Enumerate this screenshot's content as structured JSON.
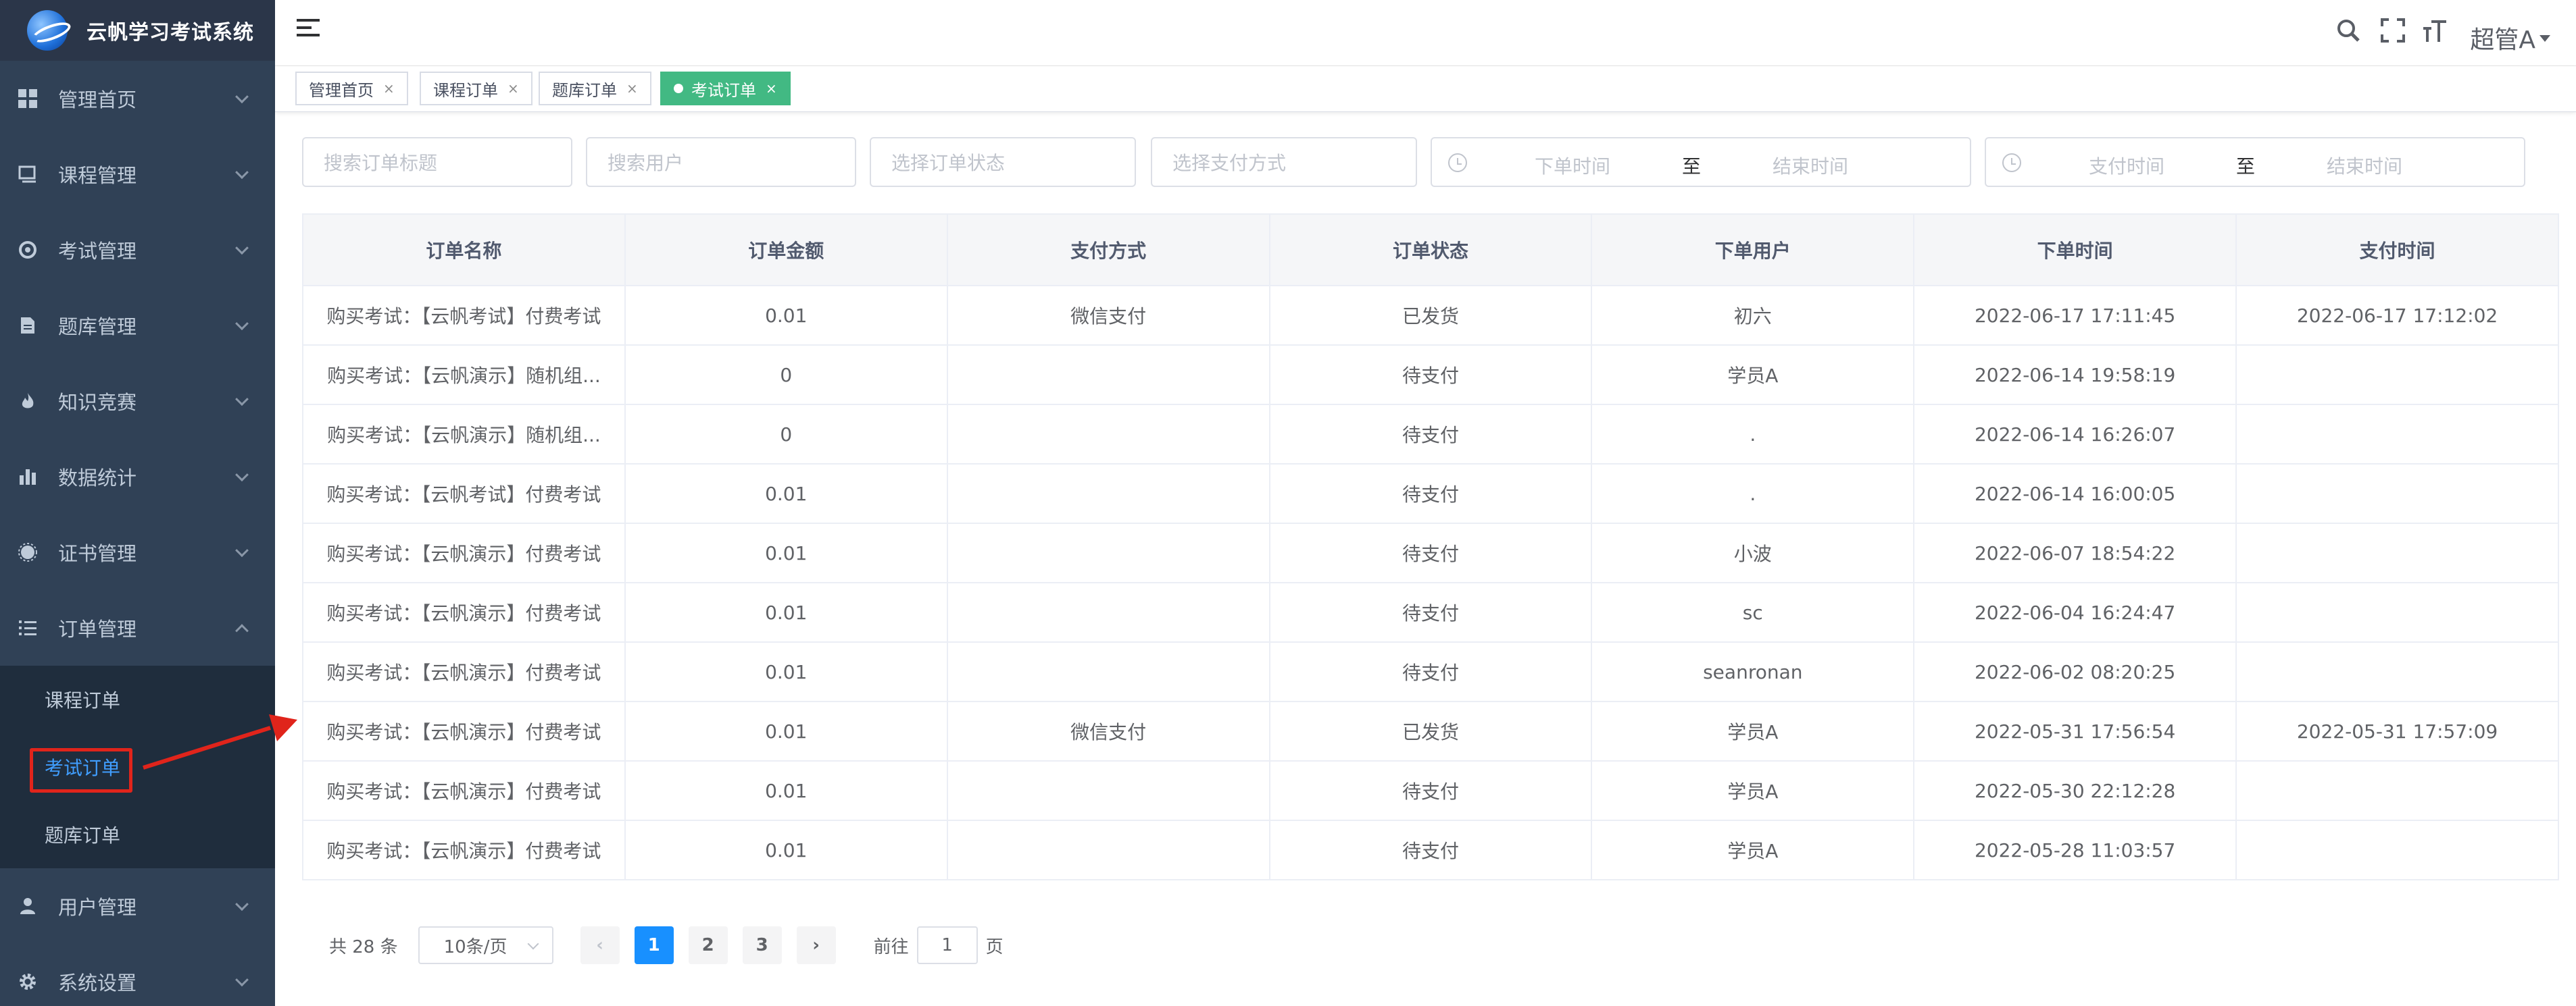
{
  "app": {
    "title": "云帆学习考试系统"
  },
  "colors": {
    "sidebar_bg": "#304156",
    "active_tag": "#42b983",
    "primary": "#1890ff",
    "annotation": "#e0241b"
  },
  "sidebar": {
    "items": [
      {
        "label": "管理首页",
        "icon": "dashboard-icon"
      },
      {
        "label": "课程管理",
        "icon": "book-icon"
      },
      {
        "label": "考试管理",
        "icon": "exam-icon"
      },
      {
        "label": "题库管理",
        "icon": "document-icon"
      },
      {
        "label": "知识竞赛",
        "icon": "fire-icon"
      },
      {
        "label": "数据统计",
        "icon": "bar-chart-icon"
      },
      {
        "label": "证书管理",
        "icon": "certificate-icon"
      },
      {
        "label": "订单管理",
        "icon": "list-icon"
      }
    ],
    "order_sub": [
      {
        "label": "课程订单"
      },
      {
        "label": "考试订单"
      },
      {
        "label": "题库订单"
      }
    ],
    "bottom_items": [
      {
        "label": "用户管理",
        "icon": "user-icon"
      },
      {
        "label": "系统设置",
        "icon": "gear-icon"
      }
    ]
  },
  "header": {
    "user": "超管A"
  },
  "tags": [
    {
      "label": "管理首页"
    },
    {
      "label": "课程订单"
    },
    {
      "label": "题库订单"
    },
    {
      "label": "考试订单"
    }
  ],
  "filters": {
    "title_placeholder": "搜索订单标题",
    "user_placeholder": "搜索用户",
    "state_placeholder": "选择订单状态",
    "pay_placeholder": "选择支付方式",
    "order_time_start": "下单时间",
    "order_time_sep": "至",
    "order_time_end": "结束时间",
    "pay_time_start": "支付时间",
    "pay_time_sep": "至",
    "pay_time_end": "结束时间"
  },
  "table": {
    "columns": [
      "订单名称",
      "订单金额",
      "支付方式",
      "订单状态",
      "下单用户",
      "下单时间",
      "支付时间"
    ],
    "rows": [
      [
        "购买考试：【云帆考试】付费考试",
        "0.01",
        "微信支付",
        "已发货",
        "初六",
        "2022-06-17 17:11:45",
        "2022-06-17 17:12:02"
      ],
      [
        "购买考试：【云帆演示】随机组...",
        "0",
        "",
        "待支付",
        "学员A",
        "2022-06-14 19:58:19",
        ""
      ],
      [
        "购买考试：【云帆演示】随机组...",
        "0",
        "",
        "待支付",
        ".",
        "2022-06-14 16:26:07",
        ""
      ],
      [
        "购买考试：【云帆考试】付费考试",
        "0.01",
        "",
        "待支付",
        ".",
        "2022-06-14 16:00:05",
        ""
      ],
      [
        "购买考试：【云帆演示】付费考试",
        "0.01",
        "",
        "待支付",
        "小波",
        "2022-06-07 18:54:22",
        ""
      ],
      [
        "购买考试：【云帆演示】付费考试",
        "0.01",
        "",
        "待支付",
        "sc",
        "2022-06-04 16:24:47",
        ""
      ],
      [
        "购买考试：【云帆演示】付费考试",
        "0.01",
        "",
        "待支付",
        "seanronan",
        "2022-06-02 08:20:25",
        ""
      ],
      [
        "购买考试：【云帆演示】付费考试",
        "0.01",
        "微信支付",
        "已发货",
        "学员A",
        "2022-05-31 17:56:54",
        "2022-05-31 17:57:09"
      ],
      [
        "购买考试：【云帆演示】付费考试",
        "0.01",
        "",
        "待支付",
        "学员A",
        "2022-05-30 22:12:28",
        ""
      ],
      [
        "购买考试：【云帆演示】付费考试",
        "0.01",
        "",
        "待支付",
        "学员A",
        "2022-05-28 11:03:57",
        ""
      ]
    ]
  },
  "pagination": {
    "total": "共 28 条",
    "page_size": "10条/页",
    "pages": [
      "1",
      "2",
      "3"
    ],
    "current": "1",
    "jump_prefix": "前往",
    "jump_value": "1",
    "jump_suffix": "页"
  }
}
